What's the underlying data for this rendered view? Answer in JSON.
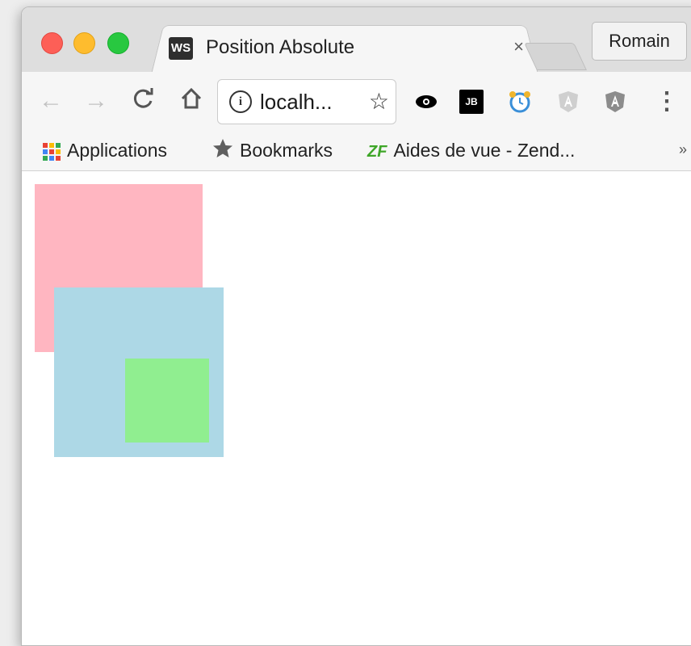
{
  "window": {
    "controls": [
      "close",
      "minimize",
      "maximize"
    ]
  },
  "tab": {
    "favicon_text": "WS",
    "title": "Position Absolute",
    "close_symbol": "×"
  },
  "profile": {
    "label": "Romain"
  },
  "toolbar": {
    "back_icon": "←",
    "forward_icon": "→",
    "reload_icon": "C",
    "home_icon": "⌂",
    "url": "localh...",
    "info_icon": "i",
    "star_icon": "☆",
    "menu_icon": "⋮",
    "extensions": [
      "eye-icon",
      "jetbrains-icon",
      "alarm-clock-icon",
      "angular-icon",
      "angular-icon"
    ]
  },
  "bookmarks": {
    "items": [
      {
        "label": "Applications",
        "icon": "apps-grid-icon"
      },
      {
        "label": "Bookmarks",
        "icon": "star-icon"
      },
      {
        "label": "Aides de vue - Zend...",
        "icon": "zf-icon"
      }
    ],
    "zf_text": "ZF",
    "more": "»"
  },
  "page": {
    "boxes": [
      {
        "name": "pink",
        "color": "#ffb6c1"
      },
      {
        "name": "blue",
        "color": "#add8e6"
      },
      {
        "name": "green",
        "color": "#90ee90"
      }
    ]
  },
  "colors": {
    "pink": "#ffb6c1",
    "blue": "#add8e6",
    "green": "#90ee90",
    "close": "#fd5f57",
    "minimize": "#febc2e",
    "maximize": "#28c840"
  }
}
